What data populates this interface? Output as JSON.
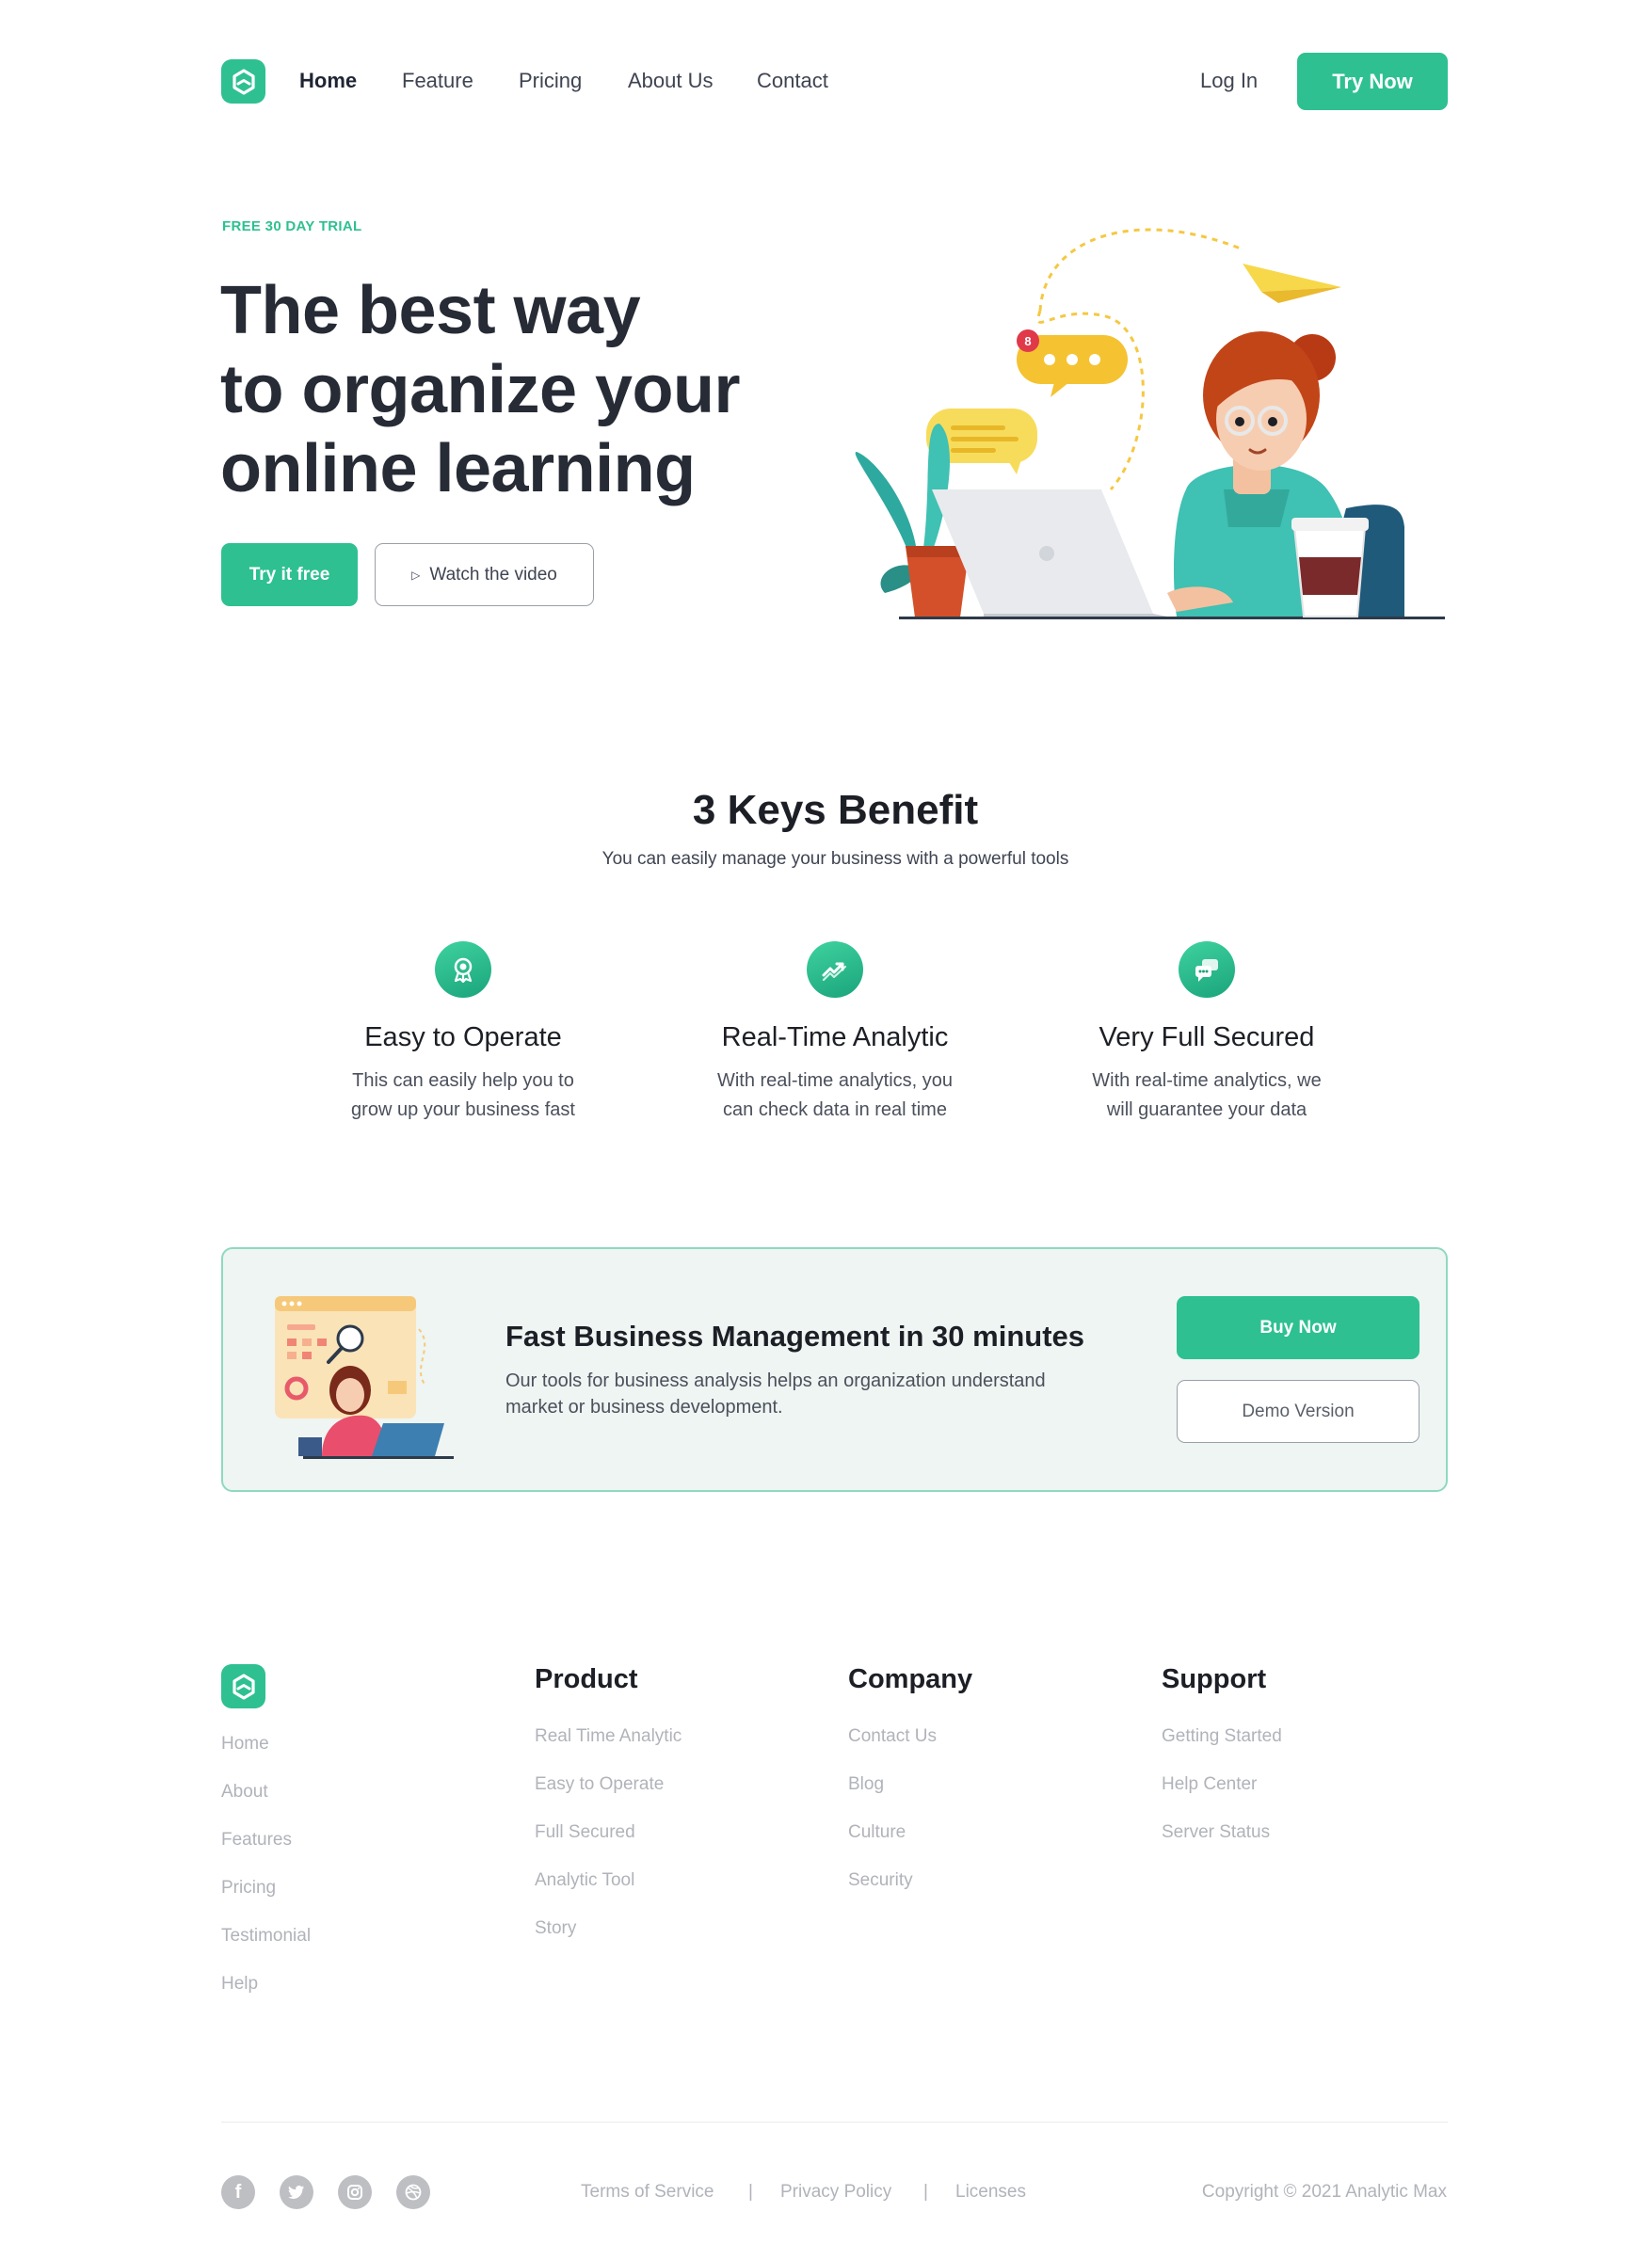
{
  "nav": {
    "links": [
      "Home",
      "Feature",
      "Pricing",
      "About Us",
      "Contact"
    ],
    "login": "Log In",
    "cta": "Try Now"
  },
  "hero": {
    "eyebrow": "FREE 30 DAY TRIAL",
    "title_lines": [
      "The best way",
      "to organize your",
      "online learning"
    ],
    "primary_button": "Try it free",
    "secondary_button": "Watch the video",
    "notification_count": "8"
  },
  "benefits": {
    "title": "3 Keys Benefit",
    "subtitle": "You can easily manage your business with a powerful tools",
    "items": [
      {
        "title": "Easy to Operate",
        "text_lines": [
          "This can easily help you to",
          "grow up your business fast"
        ],
        "icon": "badge-icon"
      },
      {
        "title": "Real-Time Analytic",
        "text_lines": [
          "With real-time analytics, you",
          "can check data in real time"
        ],
        "icon": "trend-chart-icon"
      },
      {
        "title": "Very Full Secured",
        "text_lines": [
          "With real-time analytics, we",
          "will guarantee your data"
        ],
        "icon": "chat-bubbles-icon"
      }
    ]
  },
  "banner": {
    "title": "Fast Business Management in 30 minutes",
    "text_lines": [
      "Our tools for business analysis helps an organization understand",
      "market or business development."
    ],
    "primary_button": "Buy Now",
    "secondary_button": "Demo Version"
  },
  "footer": {
    "left_links": [
      "Home",
      "About",
      "Features",
      "Pricing",
      "Testimonial",
      "Help"
    ],
    "columns": [
      {
        "title": "Product",
        "links": [
          "Real Time Analytic",
          "Easy to Operate",
          "Full Secured",
          "Analytic Tool",
          "Story"
        ]
      },
      {
        "title": "Company",
        "links": [
          "Contact Us",
          "Blog",
          "Culture",
          "Security"
        ]
      },
      {
        "title": "Support",
        "links": [
          "Getting Started",
          "Help Center",
          "Server Status"
        ]
      }
    ],
    "social_icons": [
      "facebook-icon",
      "twitter-icon",
      "instagram-icon",
      "dribbble-icon"
    ],
    "legal": [
      "Terms of Service",
      "|",
      "Privacy Policy",
      "|",
      "Licenses"
    ],
    "copyright": "Copyright © 2021 Analytic Max"
  },
  "colors": {
    "accent": "#2ec091",
    "heading": "#262b35",
    "banner_bg": "#eef5f2",
    "banner_border": "#8fd9bf",
    "muted": "#b0b3b9"
  }
}
